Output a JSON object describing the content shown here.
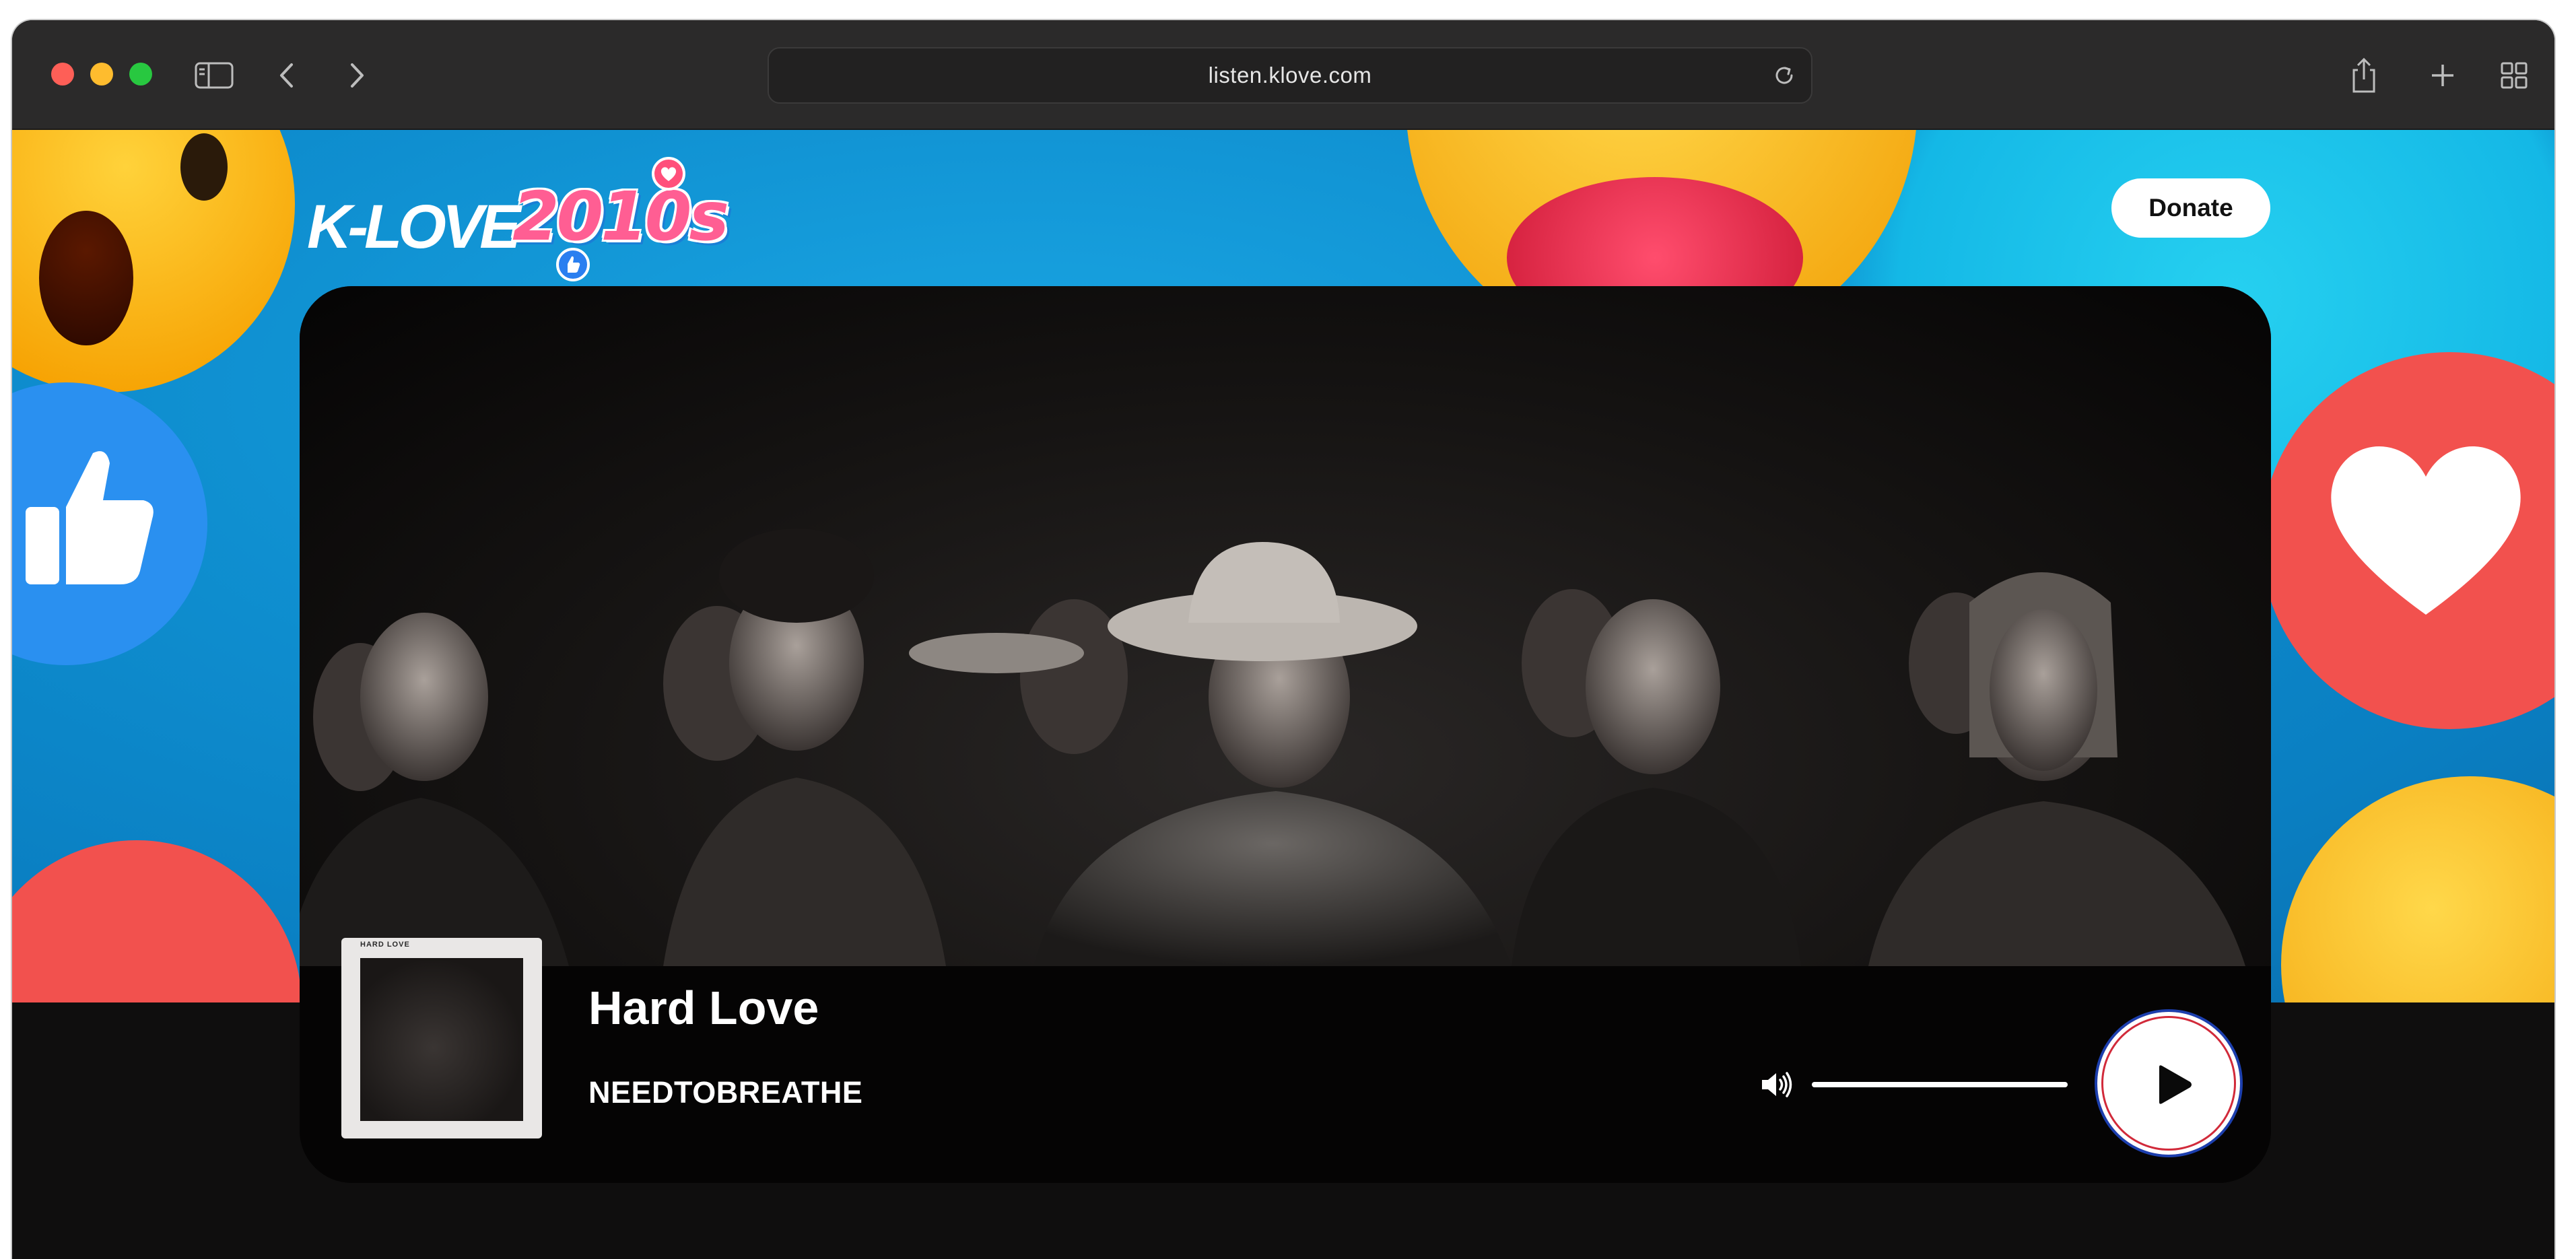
{
  "browser": {
    "url": "listen.klove.com"
  },
  "header": {
    "logo_text": "K-LOVE",
    "logo_badge": "2010s",
    "donate_label": "Donate"
  },
  "player": {
    "track_title": "Hard Love",
    "artist": "NEEDTOBREATHE",
    "album_cover_text": "HARD LOVE",
    "volume_level": 1.0,
    "state": "paused"
  },
  "colors": {
    "page_bg": "#0f0e0e",
    "hero_blue": "#0f8fd0",
    "player_bg": "#050404",
    "play_ring_blue": "#1c3fae",
    "play_ring_red": "#d12a3a"
  },
  "icons": {
    "sidebar": "sidebar-icon",
    "back": "chevron-left-icon",
    "forward": "chevron-right-icon",
    "reload": "reload-icon",
    "share": "share-icon",
    "new_tab": "plus-icon",
    "tabs": "tab-overview-icon",
    "volume": "speaker-icon",
    "play": "play-icon"
  }
}
